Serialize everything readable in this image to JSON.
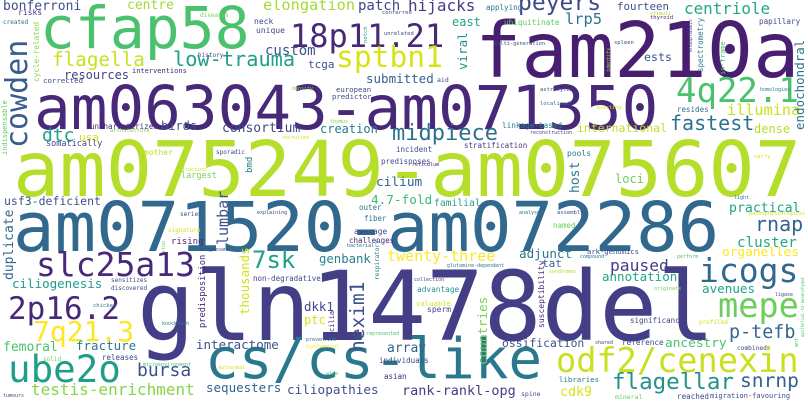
{
  "words": [
    {
      "text": "am075249-am075607",
      "color": "#b5de2b"
    },
    {
      "text": "am071520-am072286",
      "color": "#31688e"
    },
    {
      "text": "gln1478del",
      "color": "#433e85"
    },
    {
      "text": "am063043-am071350",
      "color": "#482878"
    },
    {
      "text": "fam210a",
      "color": "#481f70"
    },
    {
      "text": "cfap58",
      "color": "#4ac16d"
    },
    {
      "text": "cs/cs-like",
      "color": "#2a788e"
    },
    {
      "text": "18p11.21",
      "color": "#482878"
    },
    {
      "text": "sptbn1",
      "color": "#d8e219"
    },
    {
      "text": "4q22.1",
      "color": "#4ac16d"
    },
    {
      "text": "odf2/cenexin",
      "color": "#c8e020"
    },
    {
      "text": "icogs",
      "color": "#31688e"
    },
    {
      "text": "mepe",
      "color": "#6ccd5a"
    },
    {
      "text": "slc25a13",
      "color": "#482878"
    },
    {
      "text": "2p16.2",
      "color": "#482878"
    },
    {
      "text": "7q21.3",
      "color": "#fde725"
    },
    {
      "text": "ube2o",
      "color": "#1f9e89"
    },
    {
      "text": "cowden",
      "color": "#365d8d"
    },
    {
      "text": "peyers",
      "color": "#3e4989"
    },
    {
      "text": "elongation",
      "color": "#a5db36"
    },
    {
      "text": "low-trauma",
      "color": "#1fa187"
    },
    {
      "text": "flagella",
      "color": "#c8e020"
    },
    {
      "text": "midpiece",
      "color": "#2c728e"
    },
    {
      "text": "fastest",
      "color": "#2c728e"
    },
    {
      "text": "flagellar",
      "color": "#21918c"
    },
    {
      "text": "twenty-three",
      "color": "#fde725"
    },
    {
      "text": "7sk",
      "color": "#1f9e89"
    },
    {
      "text": "hexim1",
      "color": "#3b528b"
    },
    {
      "text": "p-tefb",
      "color": "#31688e"
    },
    {
      "text": "snrnp",
      "color": "#33638d"
    },
    {
      "text": "rnap",
      "color": "#33638d"
    },
    {
      "text": "testis-enrichment",
      "color": "#86d549"
    },
    {
      "text": "bursa",
      "color": "#3b528b"
    },
    {
      "text": "centriole",
      "color": "#22a884"
    },
    {
      "text": "dtc",
      "color": "#1f9e89"
    },
    {
      "text": "paused",
      "color": "#433e85"
    },
    {
      "text": "lrp5",
      "color": "#2c728e"
    },
    {
      "text": "illumina",
      "color": "#c8e020"
    },
    {
      "text": "hijacks",
      "color": "#433e85"
    },
    {
      "text": "lumbar",
      "color": "#3b528b"
    },
    {
      "text": "ancestry",
      "color": "#4ac16d"
    },
    {
      "text": "cluster",
      "color": "#22a884"
    },
    {
      "text": "organelles",
      "color": "#fde725"
    },
    {
      "text": "practical",
      "color": "#20a486"
    },
    {
      "text": "interactome",
      "color": "#3b528b"
    },
    {
      "text": "sequesters",
      "color": "#33638d"
    },
    {
      "text": "ciliopathies",
      "color": "#3b528b"
    },
    {
      "text": "rank-rankl-opg",
      "color": "#433e85"
    },
    {
      "text": "countries",
      "color": "#7ad151"
    },
    {
      "text": "array",
      "color": "#33638d"
    },
    {
      "text": "ossification",
      "color": "#3b528b"
    },
    {
      "text": "annotation",
      "color": "#20a486"
    },
    {
      "text": "avenues",
      "color": "#20a486"
    },
    {
      "text": "cdk9",
      "color": "#d8e219"
    },
    {
      "text": "femoral",
      "color": "#4ac16d"
    },
    {
      "text": "fracture",
      "color": "#2a788e"
    },
    {
      "text": "ciliogenesis",
      "color": "#1f9e89"
    },
    {
      "text": "usf3-deficient",
      "color": "#3b528b"
    },
    {
      "text": "duplicate",
      "color": "#31688e"
    },
    {
      "text": "thousands",
      "color": "#d2e21b"
    },
    {
      "text": "bonferroni",
      "color": "#3b528b"
    },
    {
      "text": "centre",
      "color": "#a0da39"
    },
    {
      "text": "patch",
      "color": "#3e4989"
    },
    {
      "text": "custom",
      "color": "#3b528b"
    },
    {
      "text": "tcga",
      "color": "#3b528b"
    },
    {
      "text": "resources",
      "color": "#414487"
    },
    {
      "text": "submitted",
      "color": "#33638d"
    },
    {
      "text": "east",
      "color": "#20a486"
    },
    {
      "text": "viral",
      "color": "#21918c"
    },
    {
      "text": "fourteen",
      "color": "#3b528b"
    },
    {
      "text": "ests",
      "color": "#3b528b"
    },
    {
      "text": "endochondral",
      "color": "#2c728e"
    },
    {
      "text": "international",
      "color": "#c2df23"
    },
    {
      "text": "dense",
      "color": "#b5de2b"
    },
    {
      "text": "consortium",
      "color": "#3e4989"
    },
    {
      "text": "creation",
      "color": "#2a788e"
    },
    {
      "text": "birds",
      "color": "#3b528b"
    },
    {
      "text": "usa",
      "color": "#d8e219"
    },
    {
      "text": "host",
      "color": "#2a788e"
    },
    {
      "text": "loci",
      "color": "#6ccd5a"
    },
    {
      "text": "cilium",
      "color": "#33638d"
    },
    {
      "text": "4.7-fold",
      "color": "#3aba76"
    },
    {
      "text": "familial",
      "color": "#2a9d8f"
    },
    {
      "text": "genbank",
      "color": "#26828e"
    },
    {
      "text": "adjunct",
      "color": "#2a788e"
    },
    {
      "text": "tat",
      "color": "#31688e"
    },
    {
      "text": "dkk1",
      "color": "#3e4989"
    },
    {
      "text": "ptc",
      "color": "#d8e219"
    },
    {
      "text": "rising",
      "color": "#482878"
    },
    {
      "text": "largest",
      "color": "#7ad151"
    },
    {
      "text": "mother",
      "color": "#bddf26"
    },
    {
      "text": "somatically",
      "color": "#3e4989"
    },
    {
      "text": "uncharacterized",
      "color": "#482878"
    },
    {
      "text": "interventions",
      "color": "#482878"
    },
    {
      "text": "corrected",
      "color": "#3e4989"
    },
    {
      "text": "risks",
      "color": "#46337e"
    },
    {
      "text": "cycle-related",
      "color": "#86d549"
    },
    {
      "text": "indispensable",
      "color": "#5ec962"
    },
    {
      "text": "bmd",
      "color": "#2a788e"
    },
    {
      "text": "non-degradative",
      "color": "#3e4989"
    },
    {
      "text": "predisposition",
      "color": "#482878"
    },
    {
      "text": "susceptibility",
      "color": "#482878"
    },
    {
      "text": "releases",
      "color": "#3e4989"
    },
    {
      "text": "sensitizes",
      "color": "#3e4989"
    },
    {
      "text": "discovered",
      "color": "#3e4989"
    },
    {
      "text": "chicken",
      "color": "#2a788e"
    },
    {
      "text": "knockdown",
      "color": "#2a788e"
    },
    {
      "text": "solid",
      "color": "#7ad151"
    },
    {
      "text": "microenvironment",
      "color": "#4ac16d"
    },
    {
      "text": "autosomal",
      "color": "#d8e219"
    },
    {
      "text": "tumours",
      "color": "#3e4989"
    },
    {
      "text": "series",
      "color": "#3e4989"
    },
    {
      "text": "signature",
      "color": "#d8e219"
    },
    {
      "text": "diagnosed",
      "color": "#3e4989"
    },
    {
      "text": "stop",
      "color": "#7ad151"
    },
    {
      "text": "explaining",
      "color": "#3e4989"
    },
    {
      "text": "sporadic",
      "color": "#3e4989"
    },
    {
      "text": "fraction",
      "color": "#d2e21b"
    },
    {
      "text": "architecture",
      "color": "#7ad151"
    },
    {
      "text": "created",
      "color": "#2c728e"
    },
    {
      "text": "diseases",
      "color": "#7ad151"
    },
    {
      "text": "history",
      "color": "#3e4989"
    },
    {
      "text": "neck",
      "color": "#3e4989"
    },
    {
      "text": "unique",
      "color": "#3e4989"
    },
    {
      "text": "conferred",
      "color": "#3e4989"
    },
    {
      "text": "applying",
      "color": "#2a788e"
    },
    {
      "text": "ubiquitinate",
      "color": "#5ec962"
    },
    {
      "text": "notch",
      "color": "#1f9e89"
    },
    {
      "text": "unrelated",
      "color": "#3e4989"
    },
    {
      "text": "multi-generation",
      "color": "#3e4989"
    },
    {
      "text": "density",
      "color": "#7ad151"
    },
    {
      "text": "european",
      "color": "#3e4989"
    },
    {
      "text": "predictor",
      "color": "#3e4989"
    },
    {
      "text": "aid",
      "color": "#3e4989"
    },
    {
      "text": "thymus",
      "color": "#7ad151"
    },
    {
      "text": "linkage-based",
      "color": "#26828e"
    },
    {
      "text": "stimuli",
      "color": "#addc30"
    },
    {
      "text": "thyroid",
      "color": "#482878"
    },
    {
      "text": "papillary",
      "color": "#3e4989"
    },
    {
      "text": "endoplasmic",
      "color": "#3e4989"
    },
    {
      "text": "spectrometry",
      "color": "#2a788e"
    },
    {
      "text": "in-frame",
      "color": "#4ac16d"
    },
    {
      "text": "spleen",
      "color": "#3e4989"
    },
    {
      "text": "identify",
      "color": "#a0da39"
    },
    {
      "text": "astrocytes",
      "color": "#3e4989"
    },
    {
      "text": "homologies",
      "color": "#2a788e"
    },
    {
      "text": "localized",
      "color": "#2a788e"
    },
    {
      "text": "existing",
      "color": "#d8e219"
    },
    {
      "text": "resides",
      "color": "#2c728e"
    },
    {
      "text": "reconstruction",
      "color": "#3e4989"
    },
    {
      "text": "recruited",
      "color": "#d8e219"
    },
    {
      "text": "incident",
      "color": "#3e4989"
    },
    {
      "text": "stratification",
      "color": "#46337e"
    },
    {
      "text": "predisposes",
      "color": "#3e4989"
    },
    {
      "text": "reticulum",
      "color": "#482878"
    },
    {
      "text": "outer",
      "color": "#2a788e"
    },
    {
      "text": "fiber",
      "color": "#2a788e"
    },
    {
      "text": "analysed",
      "color": "#2a788e"
    },
    {
      "text": "average",
      "color": "#3e4989"
    },
    {
      "text": "challenges",
      "color": "#482878"
    },
    {
      "text": "bacterial",
      "color": "#2a788e"
    },
    {
      "text": "respiratory",
      "color": "#2a788e"
    },
    {
      "text": "glutamine-dependent",
      "color": "#2a788e"
    },
    {
      "text": "pools",
      "color": "#2a788e"
    },
    {
      "text": "carry",
      "color": "#d8e219"
    },
    {
      "text": "light",
      "color": "#2a788e"
    },
    {
      "text": "pathophysiological",
      "color": "#d2e21b"
    },
    {
      "text": "assembly",
      "color": "#3e4989"
    },
    {
      "text": "named",
      "color": "#6ccd5a"
    },
    {
      "text": "ark-genomics",
      "color": "#3e4989"
    },
    {
      "text": "compound",
      "color": "#2a788e"
    },
    {
      "text": "perform",
      "color": "#4ac16d"
    },
    {
      "text": "syndromes",
      "color": "#addc30"
    },
    {
      "text": "originate",
      "color": "#7ad151"
    },
    {
      "text": "ligase",
      "color": "#3e4989"
    },
    {
      "text": "epithelial-to-mesenchymal",
      "color": "#4ac16d"
    },
    {
      "text": "wnt",
      "color": "#4ac16d"
    },
    {
      "text": "significance",
      "color": "#3e4989"
    },
    {
      "text": "profiled",
      "color": "#d2e21b"
    },
    {
      "text": "shared",
      "color": "#3e4989"
    },
    {
      "text": "reference",
      "color": "#3e4989"
    },
    {
      "text": "combined",
      "color": "#3e4989"
    },
    {
      "text": "libraries",
      "color": "#2a788e"
    },
    {
      "text": "mineral",
      "color": "#6ccd5a"
    },
    {
      "text": "reached",
      "color": "#3e4989"
    },
    {
      "text": "migration-favouring",
      "color": "#3e4989"
    },
    {
      "text": "cilia",
      "color": "#482878"
    },
    {
      "text": "collection",
      "color": "#3e4989"
    },
    {
      "text": "advantage",
      "color": "#21918c"
    },
    {
      "text": "valuable",
      "color": "#d2e21b"
    },
    {
      "text": "sperm",
      "color": "#3e4989"
    },
    {
      "text": "represented",
      "color": "#4ac16d"
    },
    {
      "text": "preventive",
      "color": "#2a788e"
    },
    {
      "text": "biochemical",
      "color": "#fde725"
    },
    {
      "text": "individuals",
      "color": "#3e4989"
    },
    {
      "text": "asian",
      "color": "#482878"
    },
    {
      "text": "wide",
      "color": "#4ac16d"
    },
    {
      "text": "spine",
      "color": "#3e4989"
    }
  ]
}
